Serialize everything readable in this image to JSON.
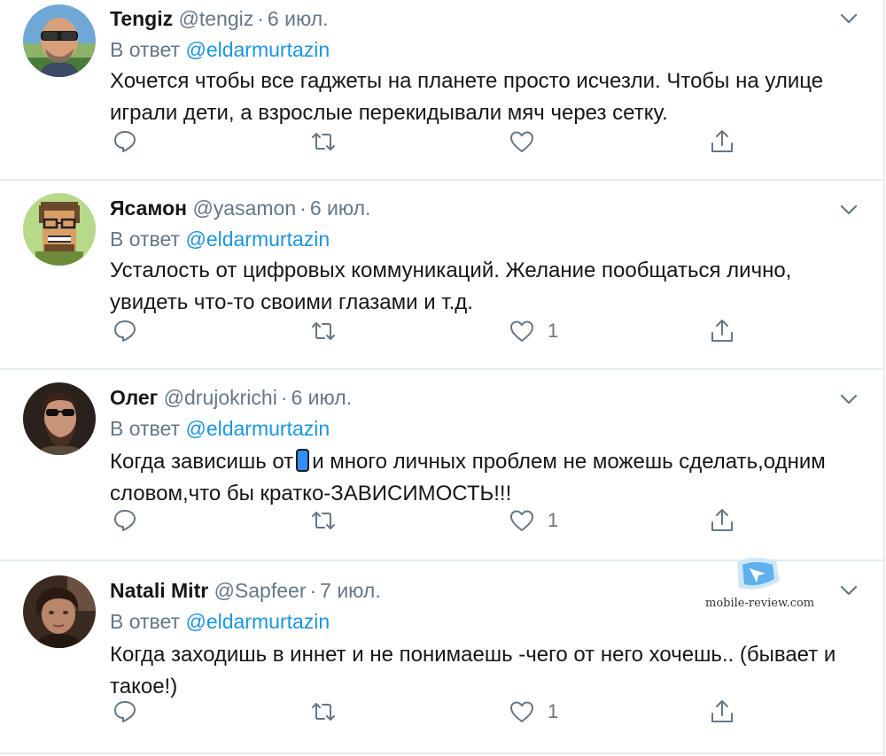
{
  "colors": {
    "text": "#14171a",
    "muted": "#657786",
    "link": "#1b95e0",
    "divider": "#e6ecf0"
  },
  "reply_prefix": "В ответ",
  "tweets": [
    {
      "name": "Tengiz",
      "handle": "@tengiz",
      "date": "6 июл.",
      "reply_to": "@eldarmurtazin",
      "text": "Хочется чтобы все гаджеты на планете просто исчезли. Чтобы на улице играли дети, а взрослые перекидывали мяч через сетку.",
      "likes": ""
    },
    {
      "name": "Ясамон",
      "handle": "@yasamon",
      "date": "6 июл.",
      "reply_to": "@eldarmurtazin",
      "text": "Усталость от цифровых коммуникаций. Желание пообщаться лично, увидеть что-то своими глазами и т.д.",
      "likes": "1"
    },
    {
      "name": "Олег",
      "handle": "@drujokrichi",
      "date": "6 июл.",
      "reply_to": "@eldarmurtazin",
      "text_before_emoji": "Когда зависишь от",
      "text_emoji": "mobile-phone-emoji",
      "text_after_emoji": "и много личных проблем не можешь сделать,одним словом,что бы кратко-ЗАВИСИМОСТЬ!!!",
      "likes": "1"
    },
    {
      "name": "Natali Mitr",
      "handle": "@Sapfeer",
      "date": "7 июл.",
      "reply_to": "@eldarmurtazin",
      "text": "Когда заходишь в иннет и не понимаешь -чего от него хочешь.. (бывает и такое!)",
      "likes": "1"
    }
  ],
  "icons": {
    "reply": "reply-icon",
    "retweet": "retweet-icon",
    "like": "heart-icon",
    "share": "share-icon",
    "more": "chevron-down-icon"
  },
  "watermark": {
    "text": "mobile-review.com"
  }
}
